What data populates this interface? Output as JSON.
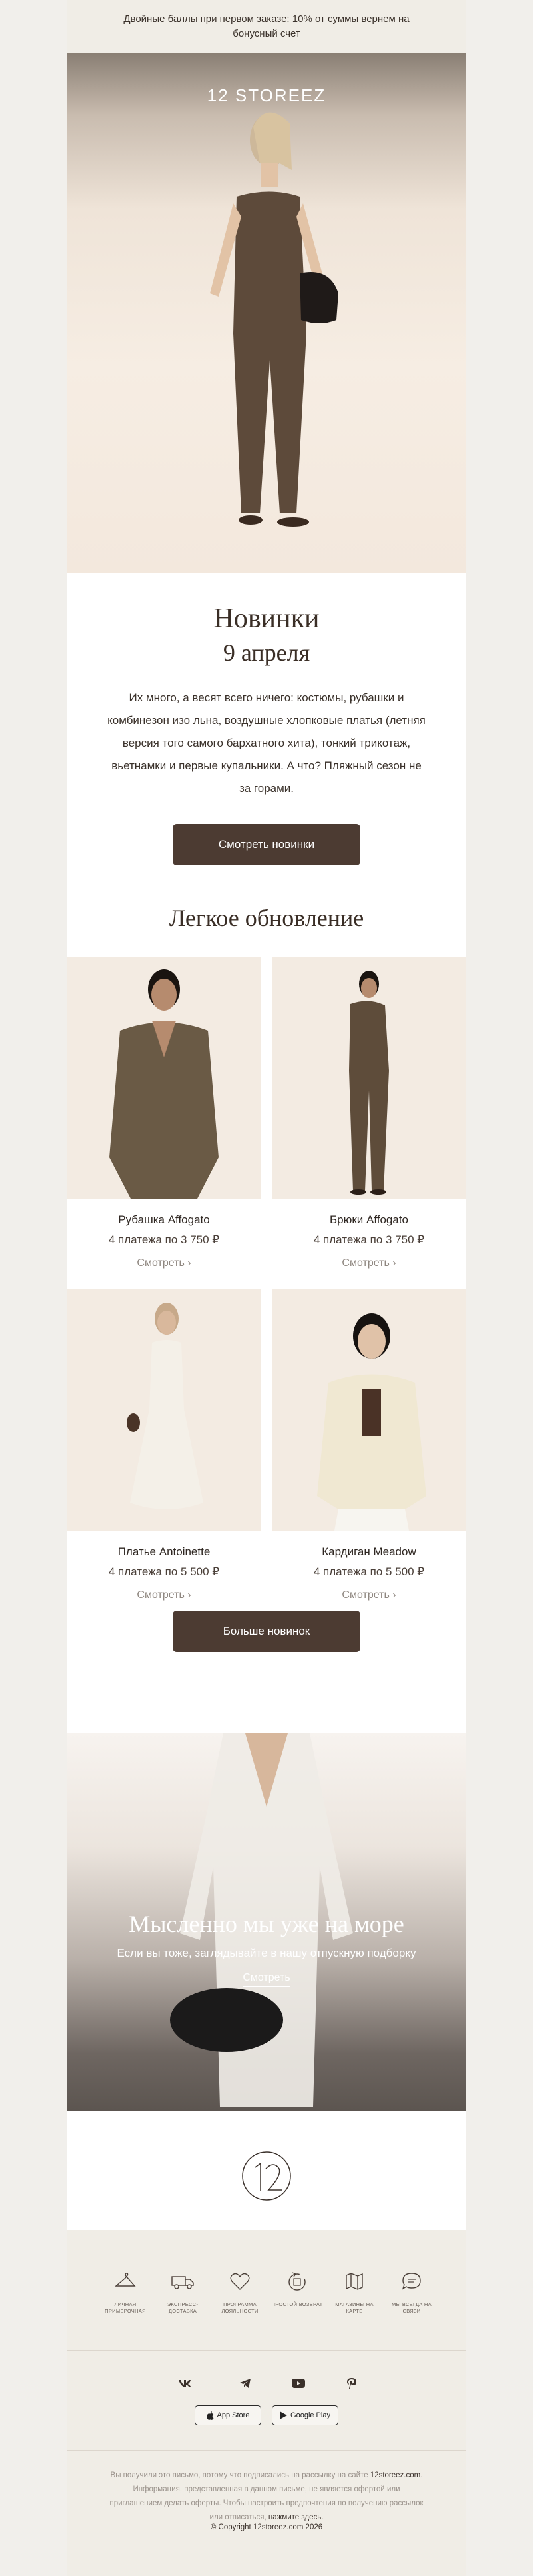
{
  "topbar": {
    "text": "Двойные баллы при первом заказе: 10% от суммы вернем на бонусный счет"
  },
  "brand": {
    "name": "12 STOREEZ"
  },
  "intro": {
    "title": "Новинки",
    "date": "9 апреля",
    "text": "Их много, а весят всего ничего: костюмы, рубашки и комбинезон изо льна, воздушные хлопковые платья (летняя версия того самого бархатного хита), тонкий трикотаж, вьетнамки и первые купальники. А что? Пляжный сезон не за горами.",
    "button": "Смотреть новинки"
  },
  "section": {
    "title": "Легкое обновление"
  },
  "products": [
    {
      "name": "Рубашка Affogato",
      "price": "4 платежа по 3 750 ₽",
      "link": "Смотреть ›"
    },
    {
      "name": "Брюки Affogato",
      "price": "4 платежа по 3 750 ₽",
      "link": "Смотреть ›"
    },
    {
      "name": "Платье Antoinette",
      "price": "4 платежа по 5 500 ₽",
      "link": "Смотреть ›"
    },
    {
      "name": "Кардиган Meadow",
      "price": "4 платежа по 5 500 ₽",
      "link": "Смотреть ›"
    }
  ],
  "more_button": "Больше новинок",
  "promo": {
    "title": "Мысленно мы уже на море",
    "subtitle": "Если вы тоже, заглядывайте в нашу отпускную подборку",
    "link": "Смотреть"
  },
  "footer": {
    "features": [
      {
        "icon": "hanger-icon",
        "label": "ЛИЧНАЯ ПРИМЕРОЧНАЯ"
      },
      {
        "icon": "truck-icon",
        "label": "ЭКСПРЕСС-ДОСТАВКА"
      },
      {
        "icon": "heart-icon",
        "label": "ПРОГРАММА ЛОЯЛЬНОСТИ"
      },
      {
        "icon": "return-icon",
        "label": "ПРОСТОЙ ВОЗВРАТ"
      },
      {
        "icon": "map-icon",
        "label": "МАГАЗИНЫ НА КАРТЕ"
      },
      {
        "icon": "chat-icon",
        "label": "МЫ ВСЕГДА НА СВЯЗИ"
      }
    ],
    "social": [
      "vk-icon",
      "telegram-icon",
      "youtube-icon",
      "pinterest-icon"
    ],
    "stores": {
      "app_store": "App Store",
      "google_play": "Google Play"
    },
    "legal_a": "Вы получили это письмо, потому что подписались на рассылку на сайте",
    "legal_site": "12storeez.com",
    "legal_b": ". Информация, представленная в данном письме, не является офертой или приглашением делать оферты. Чтобы настроить предпочтения по получению рассылок или отписаться,",
    "legal_link": "нажмите здесь.",
    "copyright": "© Copyright 12storeez.com 2026"
  }
}
